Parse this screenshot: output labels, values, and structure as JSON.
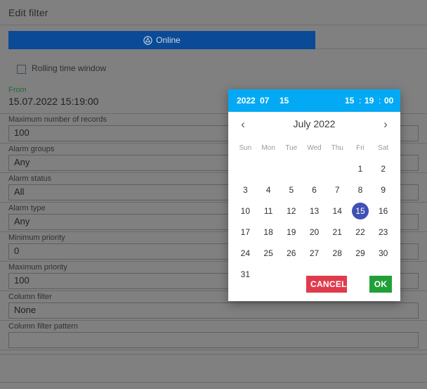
{
  "window": {
    "title": "Edit filter"
  },
  "tabs": {
    "active": {
      "label": "Online",
      "icon": "online-circle-triangle-icon"
    }
  },
  "options": {
    "rolling_time_window": {
      "label": "Rolling time window",
      "checked": false
    }
  },
  "form": {
    "fields": [
      {
        "label": "From",
        "value": "15.07.2022 15:19:00",
        "label_color": "#1e6b33",
        "style": "datetime"
      },
      {
        "label": "Maximum number of records",
        "value": "100",
        "style": "boxed"
      },
      {
        "label": "Alarm groups",
        "value": "Any",
        "style": "boxed"
      },
      {
        "label": "Alarm status",
        "value": "All",
        "style": "boxed"
      },
      {
        "label": "Alarm type",
        "value": "Any",
        "style": "boxed"
      },
      {
        "label": "Minimum priority",
        "value": "0",
        "style": "boxed"
      },
      {
        "label": "Maximum priority",
        "value": "100",
        "style": "boxed"
      },
      {
        "label": "Column filter",
        "value": "None",
        "style": "boxed"
      },
      {
        "label": "Column filter pattern",
        "value": "",
        "style": "boxed"
      }
    ]
  },
  "datepicker": {
    "header": {
      "year": "2022",
      "month": "07",
      "day": "15",
      "hour": "15",
      "colon1": ":",
      "minute": "19",
      "colon2": ":",
      "second": "00",
      "background": "#03a9f4"
    },
    "nav": {
      "prev_icon": "‹",
      "next_icon": "›",
      "month_title": "July 2022"
    },
    "weekdays": [
      "Sun",
      "Mon",
      "Tue",
      "Wed",
      "Thu",
      "Fri",
      "Sat"
    ],
    "weeks": [
      [
        "",
        "",
        "",
        "",
        "",
        "1",
        "2"
      ],
      [
        "3",
        "4",
        "5",
        "6",
        "7",
        "8",
        "9"
      ],
      [
        "10",
        "11",
        "12",
        "13",
        "14",
        "15",
        "16"
      ],
      [
        "17",
        "18",
        "19",
        "20",
        "21",
        "22",
        "23"
      ],
      [
        "24",
        "25",
        "26",
        "27",
        "28",
        "29",
        "30"
      ],
      [
        "31",
        "",
        "",
        "",
        "",
        "",
        ""
      ]
    ],
    "selected_day": "15",
    "selected_color": "#3f51b5",
    "actions": {
      "cancel_label": "CANCEL",
      "cancel_color": "#e03b4d",
      "ok_label": "OK",
      "ok_color": "#21a038"
    }
  }
}
